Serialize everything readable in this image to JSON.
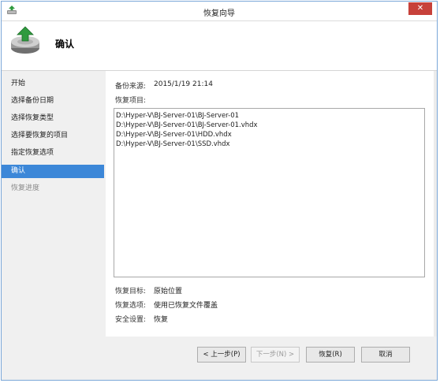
{
  "window": {
    "title": "恢复向导",
    "close_glyph": "✕"
  },
  "header": {
    "title": "确认",
    "icon": "restore-disk-icon"
  },
  "nav": {
    "items": [
      {
        "label": "开始",
        "state": "normal"
      },
      {
        "label": "选择备份日期",
        "state": "normal"
      },
      {
        "label": "选择恢复类型",
        "state": "normal"
      },
      {
        "label": "选择要恢复的项目",
        "state": "normal"
      },
      {
        "label": "指定恢复选项",
        "state": "normal"
      },
      {
        "label": "确认",
        "state": "active"
      },
      {
        "label": "恢复进度",
        "state": "disabled"
      }
    ]
  },
  "main": {
    "backup_source_label": "备份来源:",
    "backup_source_value": "2015/1/19 21:14",
    "restore_items_label": "恢复项目:",
    "restore_items": [
      "D:\\Hyper-V\\BJ-Server-01\\BJ-Server-01",
      "D:\\Hyper-V\\BJ-Server-01\\BJ-Server-01.vhdx",
      "D:\\Hyper-V\\BJ-Server-01\\HDD.vhdx",
      "D:\\Hyper-V\\BJ-Server-01\\SSD.vhdx"
    ],
    "restore_target_label": "恢复目标:",
    "restore_target_value": "原始位置",
    "restore_options_label": "恢复选项:",
    "restore_options_value": "使用已恢复文件覆盖",
    "security_label": "安全设置:",
    "security_value": "恢复"
  },
  "buttons": {
    "back": "< 上一步(P)",
    "next": "下一步(N) >",
    "restore": "恢复(R)",
    "cancel": "取消"
  },
  "colors": {
    "accent": "#3c87d8",
    "close": "#c7413a"
  }
}
